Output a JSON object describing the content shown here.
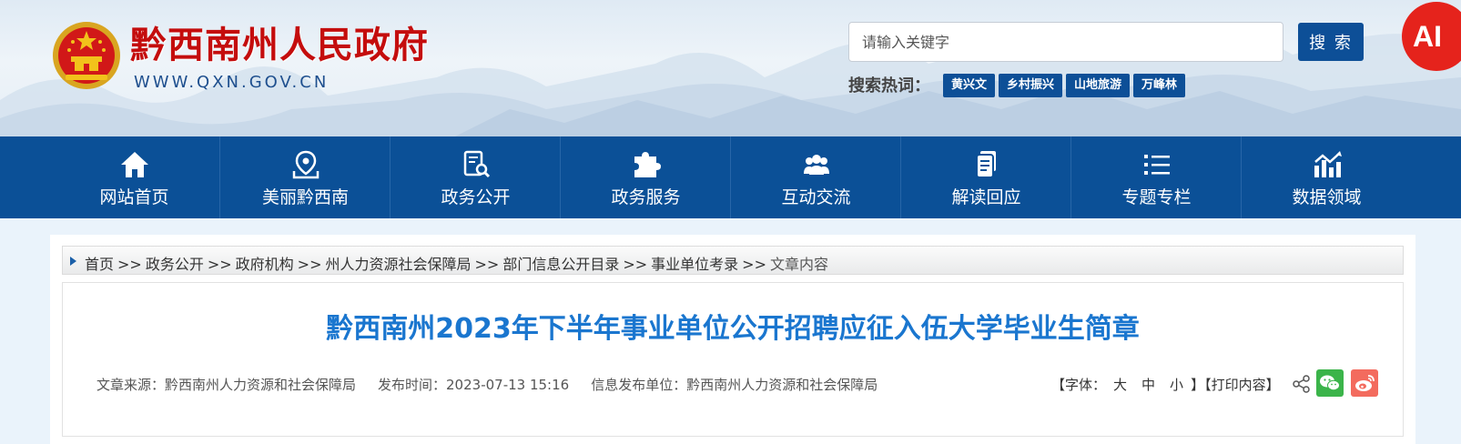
{
  "header": {
    "site_name": "黔西南州人民政府",
    "site_url": "WWW.QXN.GOV.CN",
    "search_placeholder": "请输入关键字",
    "search_button": "搜 索",
    "ai_label": "AI",
    "hot_label": "搜索热词：",
    "hot_tags": [
      "黄兴文",
      "乡村振兴",
      "山地旅游",
      "万峰林"
    ]
  },
  "nav": {
    "items": [
      {
        "label": "网站首页",
        "icon": "home-icon"
      },
      {
        "label": "美丽黔西南",
        "icon": "map-pin-icon"
      },
      {
        "label": "政务公开",
        "icon": "document-search-icon"
      },
      {
        "label": "政务服务",
        "icon": "puzzle-icon"
      },
      {
        "label": "互动交流",
        "icon": "users-icon"
      },
      {
        "label": "解读回应",
        "icon": "file-icon"
      },
      {
        "label": "专题专栏",
        "icon": "list-icon"
      },
      {
        "label": "数据领域",
        "icon": "chart-icon"
      }
    ]
  },
  "breadcrumb": {
    "items": [
      "首页",
      "政务公开",
      "政府机构",
      "州人力资源社会保障局",
      "部门信息公开目录",
      "事业单位考录"
    ],
    "separator": ">>",
    "current": "文章内容"
  },
  "article": {
    "title": "黔西南州2023年下半年事业单位公开招聘应征入伍大学毕业生简章",
    "source": "文章来源：黔西南州人力资源和社会保障局",
    "publish_time": "发布时间：2023-07-13 15:16",
    "publisher": "信息发布单位：黔西南州人力资源和社会保障局"
  },
  "tools": {
    "font_label": "【字体：",
    "font_large": "大",
    "font_medium": "中",
    "font_small": "小",
    "font_close": "】",
    "print_label": "【打印内容】"
  },
  "colors": {
    "nav_bg": "#0b5097",
    "title_blue": "#1a76cf",
    "site_red": "#c40d0d",
    "ai_red": "#e5231c"
  }
}
